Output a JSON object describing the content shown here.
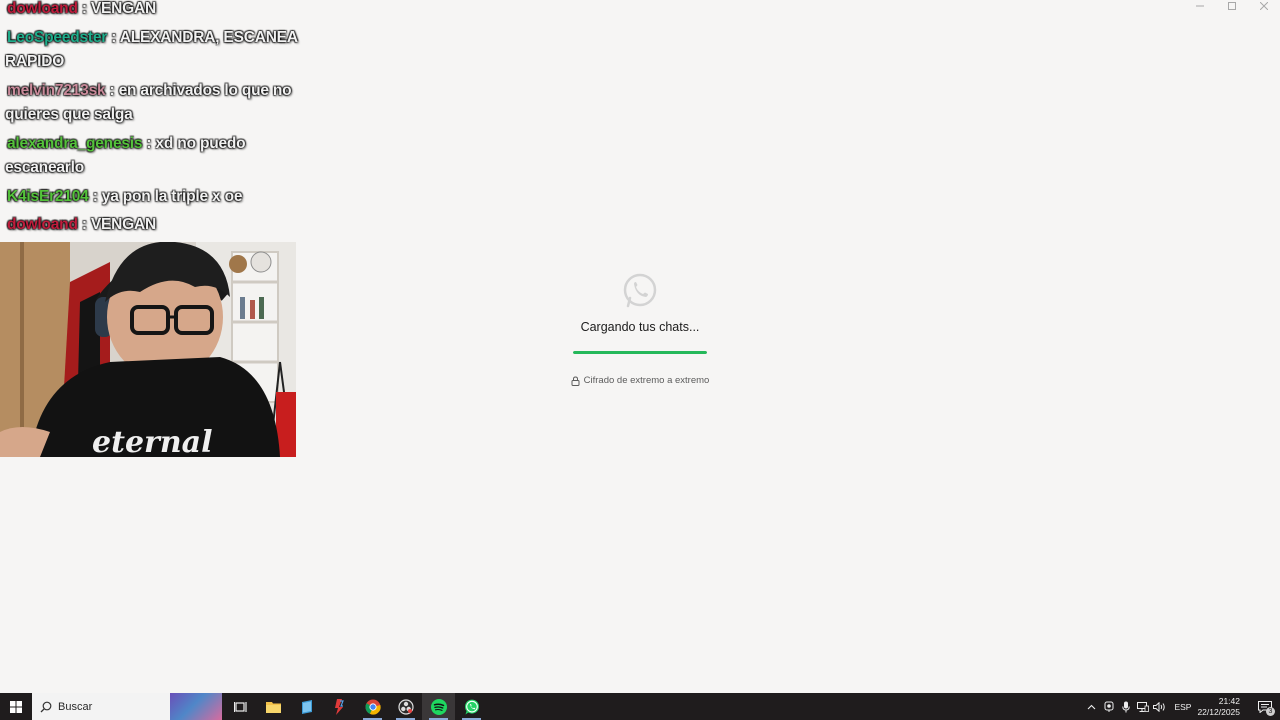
{
  "chat": {
    "messages": [
      {
        "user": "dowloand",
        "text": " : VENGAN",
        "user_color": "#c01c3c"
      },
      {
        "user": "LeoSpeedster",
        "text": " : ALEXANDRA, ESCANEA RAPIDO",
        "user_color": "#1fae8c"
      },
      {
        "user": "melvin7213sk",
        "text": " : en archivados lo que no quieres que salga",
        "user_color": "#c98a9a"
      },
      {
        "user": "alexandra_genesis",
        "text": " : xd no puedo escanearlo",
        "user_color": "#54c23b"
      },
      {
        "user": "K4isEr2104",
        "text": " : ya pon la triple x oe",
        "user_color": "#54c23b"
      },
      {
        "user": "dowloand",
        "text": " : VENGAN",
        "user_color": "#c01c3c"
      }
    ]
  },
  "webcam": {
    "shirt_text": "eternal"
  },
  "whatsapp": {
    "loading_text": "Cargando tus chats...",
    "progress": 1.0,
    "encryption_text": "Cifrado de extremo a extremo",
    "accent_color": "#25b85a"
  },
  "taskbar": {
    "search_placeholder": "Buscar",
    "apps": [
      {
        "icon": "task-view-icon"
      },
      {
        "icon": "file-explorer-icon"
      },
      {
        "icon": "notes-app-icon"
      },
      {
        "icon": "app-icon"
      },
      {
        "icon": "chrome-icon"
      },
      {
        "icon": "obs-icon"
      },
      {
        "icon": "spotify-icon"
      },
      {
        "icon": "whatsapp-icon"
      }
    ],
    "language": "ESP",
    "time": "21:42",
    "date": "22/12/2025",
    "notification_count": "3"
  }
}
